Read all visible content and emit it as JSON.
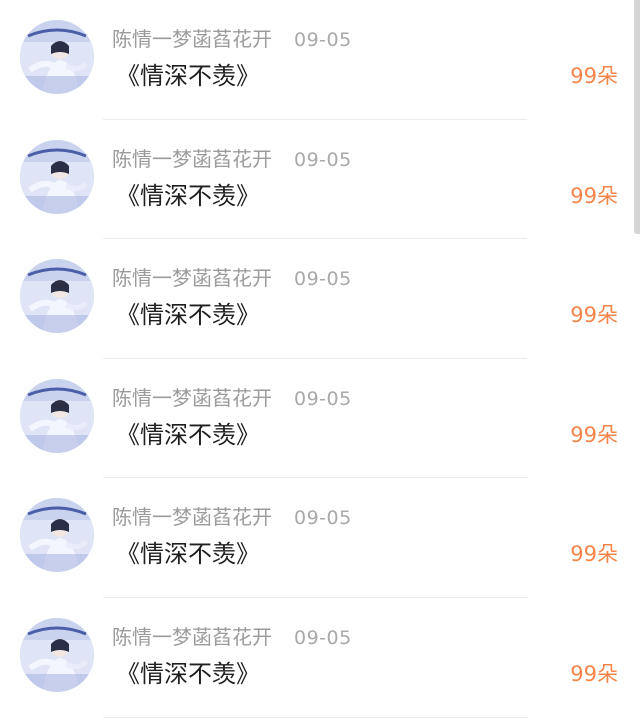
{
  "items": [
    {
      "username": "陈情一梦菡萏花开",
      "time": "09-05",
      "message": "《情深不羡》",
      "gift": "99朵"
    },
    {
      "username": "陈情一梦菡萏花开",
      "time": "09-05",
      "message": "《情深不羡》",
      "gift": "99朵"
    },
    {
      "username": "陈情一梦菡萏花开",
      "time": "09-05",
      "message": "《情深不羡》",
      "gift": "99朵"
    },
    {
      "username": "陈情一梦菡萏花开",
      "time": "09-05",
      "message": "《情深不羡》",
      "gift": "99朵"
    },
    {
      "username": "陈情一梦菡萏花开",
      "time": "09-05",
      "message": "《情深不羡》",
      "gift": "99朵"
    },
    {
      "username": "陈情一梦菡萏花开",
      "time": "09-05",
      "message": "《情深不羡》",
      "gift": "99朵"
    }
  ]
}
